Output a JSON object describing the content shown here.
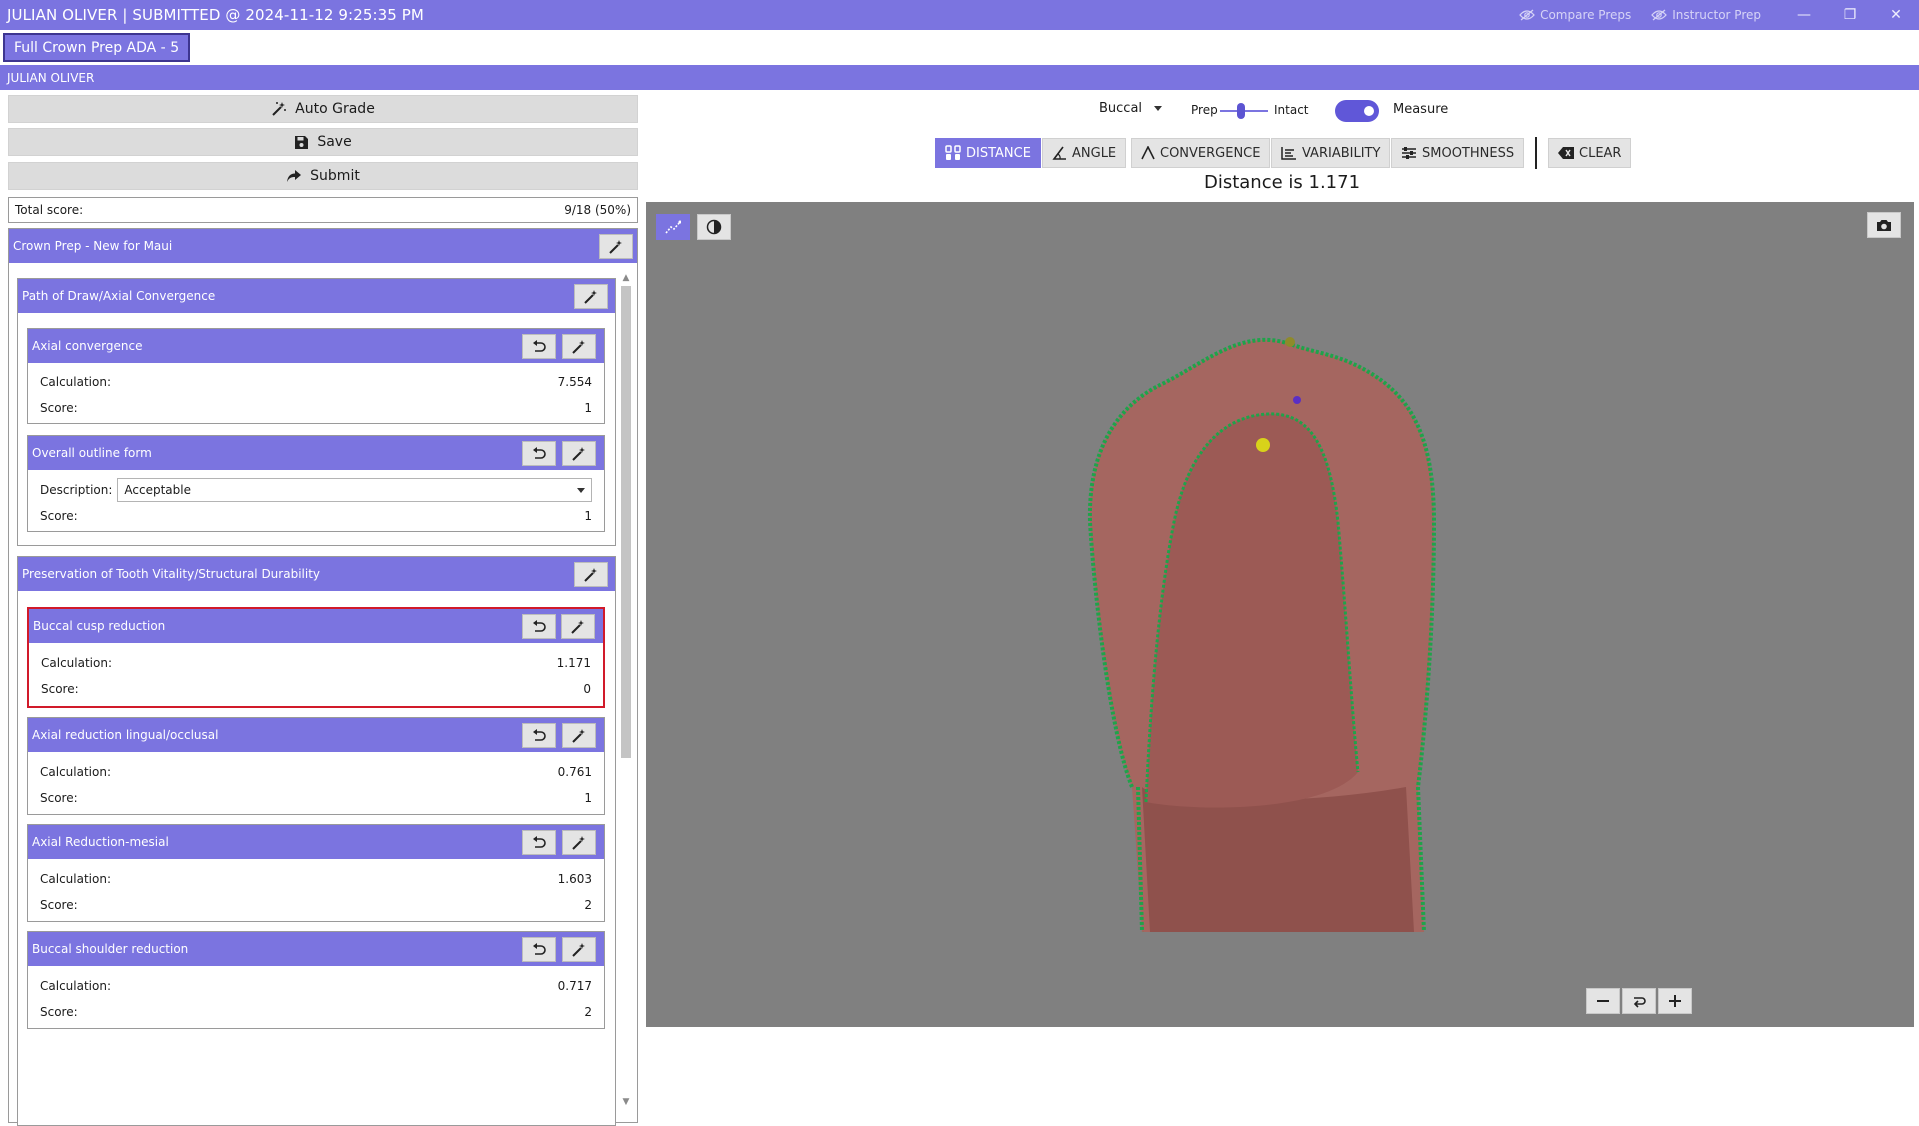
{
  "window": {
    "title": "JULIAN OLIVER | SUBMITTED @ 2024-11-12 9:25:35 PM",
    "compare_preps": "Compare Preps",
    "instructor_prep": "Instructor Prep",
    "minimize": "—",
    "restore": "❐",
    "close": "✕"
  },
  "tab": {
    "label": "Full Crown Prep ADA - 5"
  },
  "user": {
    "name": "JULIAN OLIVER"
  },
  "actions": {
    "auto_grade": "Auto Grade",
    "save": "Save",
    "submit": "Submit"
  },
  "total": {
    "label": "Total score:",
    "value": "9/18 (50%)"
  },
  "rubric": {
    "title": "Crown Prep - New for Maui",
    "sections": [
      {
        "title": "Path of Draw/Axial Convergence",
        "criteria": [
          {
            "title": "Axial convergence",
            "calc_label": "Calculation:",
            "calc": "7.554",
            "score_label": "Score:",
            "score": "1"
          },
          {
            "title": "Overall outline form",
            "desc_label": "Description:",
            "desc": "Acceptable",
            "score_label": "Score:",
            "score": "1"
          }
        ]
      },
      {
        "title": "Preservation of Tooth Vitality/Structural Durability",
        "criteria": [
          {
            "title": "Buccal cusp reduction",
            "calc_label": "Calculation:",
            "calc": "1.171",
            "score_label": "Score:",
            "score": "0"
          },
          {
            "title": "Axial reduction lingual/occlusal",
            "calc_label": "Calculation:",
            "calc": "0.761",
            "score_label": "Score:",
            "score": "1"
          },
          {
            "title": "Axial Reduction-mesial",
            "calc_label": "Calculation:",
            "calc": "1.603",
            "score_label": "Score:",
            "score": "2"
          },
          {
            "title": "Buccal shoulder reduction",
            "calc_label": "Calculation:",
            "calc": "0.717",
            "score_label": "Score:",
            "score": "2"
          }
        ]
      }
    ]
  },
  "viewer": {
    "view_select": "Buccal",
    "prep_label": "Prep",
    "intact_label": "Intact",
    "prep_intact_level": 0.42,
    "measure_label": "Measure",
    "measure_on": true,
    "tools": [
      "DISTANCE",
      "ANGLE",
      "CONVERGENCE",
      "VARIABILITY",
      "SMOOTHNESS"
    ],
    "active_tool": "DISTANCE",
    "clear": "CLEAR",
    "readout": "Distance is 1.171"
  },
  "colors": {
    "accent": "#7b74e0",
    "selected_border": "#d11a2a",
    "viewport_bg": "#808080",
    "tooth": "#a56660",
    "margin_line": "#1fa34a"
  }
}
